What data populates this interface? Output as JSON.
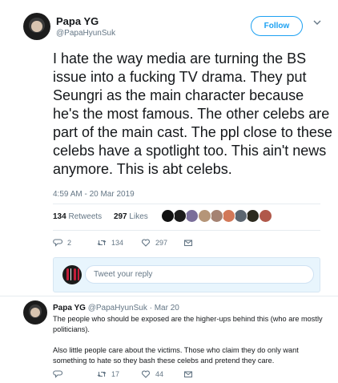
{
  "tweet": {
    "author_name": "Papa YG",
    "author_handle": "@PapaHyunSuk",
    "follow_label": "Follow",
    "text": "I hate the way media are turning the BS issue into a fucking TV drama. They put Seungri as the main character because he's the most famous. The other celebs are part of the main cast. The ppl close to these celebs have a spotlight too. This ain't news anymore. This is abt celebs.",
    "timestamp": "4:59 AM - 20 Mar 2019",
    "retweets_count": "134",
    "retweets_label": "Retweets",
    "likes_count": "297",
    "likes_label": "Likes",
    "likers": [
      {
        "icon": "liker-avatar",
        "color": "#111111"
      },
      {
        "icon": "liker-avatar",
        "color": "#1b1b1b"
      },
      {
        "icon": "liker-avatar",
        "color": "#7a6e9a"
      },
      {
        "icon": "liker-avatar",
        "color": "#b59578"
      },
      {
        "icon": "liker-avatar",
        "color": "#a58272"
      },
      {
        "icon": "liker-avatar",
        "color": "#d27858"
      },
      {
        "icon": "liker-avatar",
        "color": "#5c6670"
      },
      {
        "icon": "liker-avatar",
        "color": "#2c2a1e"
      },
      {
        "icon": "liker-avatar",
        "color": "#b0584a"
      }
    ],
    "actions": {
      "replies": "2",
      "retweets": "134",
      "likes": "297"
    }
  },
  "reply_composer": {
    "placeholder": "Tweet your reply"
  },
  "reply_tweet": {
    "author_name": "Papa YG",
    "meta": "@PapaHyunSuk · Mar 20",
    "text": "The people who should be exposed are the higher-ups behind this (who are mostly politicians).\n\nAlso little people care about the victims. Those who claim they do only want something to hate so they bash these celebs and pretend they care.",
    "actions": {
      "retweets": "17",
      "likes": "44"
    }
  },
  "colors": {
    "accent": "#1da1f2",
    "muted": "#657786",
    "text": "#14171a",
    "composer_bg": "#e8f5fd"
  }
}
